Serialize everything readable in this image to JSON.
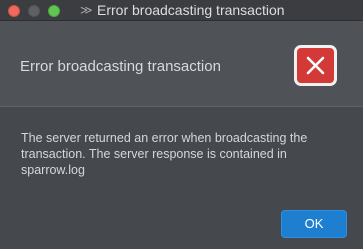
{
  "window": {
    "title": "Error broadcasting transaction",
    "app_icon": "double-chevron-icon"
  },
  "header": {
    "title": "Error broadcasting transaction",
    "icon": "close-icon",
    "icon_color": "#d33a37"
  },
  "message": {
    "text": "The server returned an error when broadcasting the transaction. The server response is contained in sparrow.log"
  },
  "buttons": {
    "ok_label": "OK",
    "ok_color": "#1e7fd1"
  },
  "traffic_lights": {
    "close_color": "#ed6a5e",
    "minimize_color": "#5d6064",
    "maximize_color": "#61c454"
  }
}
